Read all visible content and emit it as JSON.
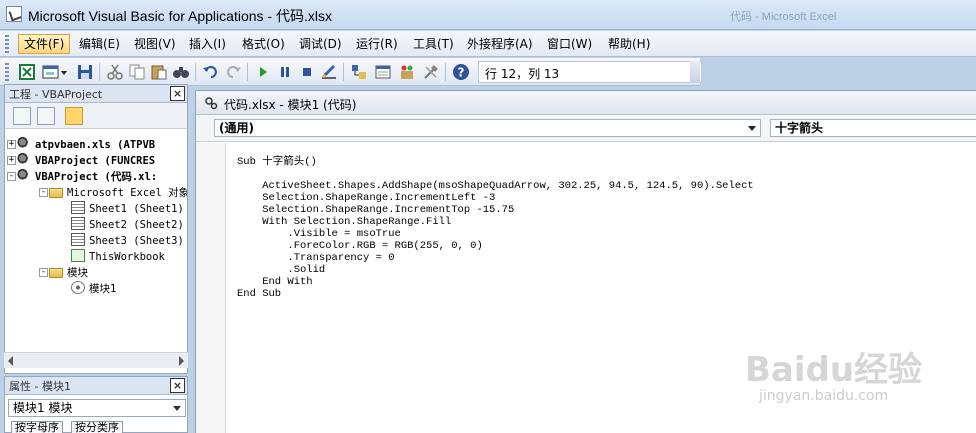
{
  "window": {
    "title": "Microsoft Visual Basic for Applications - 代码.xlsx",
    "ghost_title": "代码 - Microsoft Excel"
  },
  "menu": [
    {
      "label": "文件(F)",
      "active": true
    },
    {
      "label": "编辑(E)"
    },
    {
      "label": "视图(V)"
    },
    {
      "label": "插入(I)"
    },
    {
      "label": "格式(O)"
    },
    {
      "label": "调试(D)"
    },
    {
      "label": "运行(R)"
    },
    {
      "label": "工具(T)"
    },
    {
      "label": "外接程序(A)"
    },
    {
      "label": "窗口(W)"
    },
    {
      "label": "帮助(H)"
    }
  ],
  "toolbar": {
    "position": "行 12，列 13"
  },
  "project": {
    "title": "工程 - VBAProject",
    "tree": [
      {
        "label": "atpvbaen.xls (ATPVB",
        "icon": "vbaproject",
        "expander": "+"
      },
      {
        "label": "VBAProject (FUNCRES",
        "icon": "vbaproject",
        "expander": "+"
      },
      {
        "label": "VBAProject (代码.xl:",
        "icon": "vbaproject",
        "expander": "-"
      },
      {
        "label": "Microsoft Excel 对象",
        "icon": "folder",
        "expander": "-"
      },
      {
        "label": "Sheet1 (Sheet1)",
        "icon": "sheet"
      },
      {
        "label": "Sheet2 (Sheet2)",
        "icon": "sheet"
      },
      {
        "label": "Sheet3 (Sheet3)",
        "icon": "sheet"
      },
      {
        "label": "ThisWorkbook",
        "icon": "workbook"
      },
      {
        "label": "模块",
        "icon": "folder",
        "expander": "-"
      },
      {
        "label": "模块1",
        "icon": "module"
      }
    ]
  },
  "properties": {
    "title": "属性 - 模块1",
    "selected": "模块1 模块",
    "tabs": [
      "按字母序",
      "按分类序"
    ]
  },
  "code": {
    "window_title": "代码.xlsx - 模块1 (代码)",
    "object_combo": "(通用)",
    "procedure_combo": "十字箭头",
    "lines": [
      "Sub 十字箭头()",
      "",
      "    ActiveSheet.Shapes.AddShape(msoShapeQuadArrow, 302.25, 94.5, 124.5, 90).Select",
      "    Selection.ShapeRange.IncrementLeft -3",
      "    Selection.ShapeRange.IncrementTop -15.75",
      "    With Selection.ShapeRange.Fill",
      "        .Visible = msoTrue",
      "        .ForeColor.RGB = RGB(255, 0, 0)",
      "        .Transparency = 0",
      "        .Solid",
      "    End With",
      "End Sub"
    ]
  },
  "watermark": {
    "brand": "Baidu经验",
    "url": "jingyan.baidu.com"
  }
}
